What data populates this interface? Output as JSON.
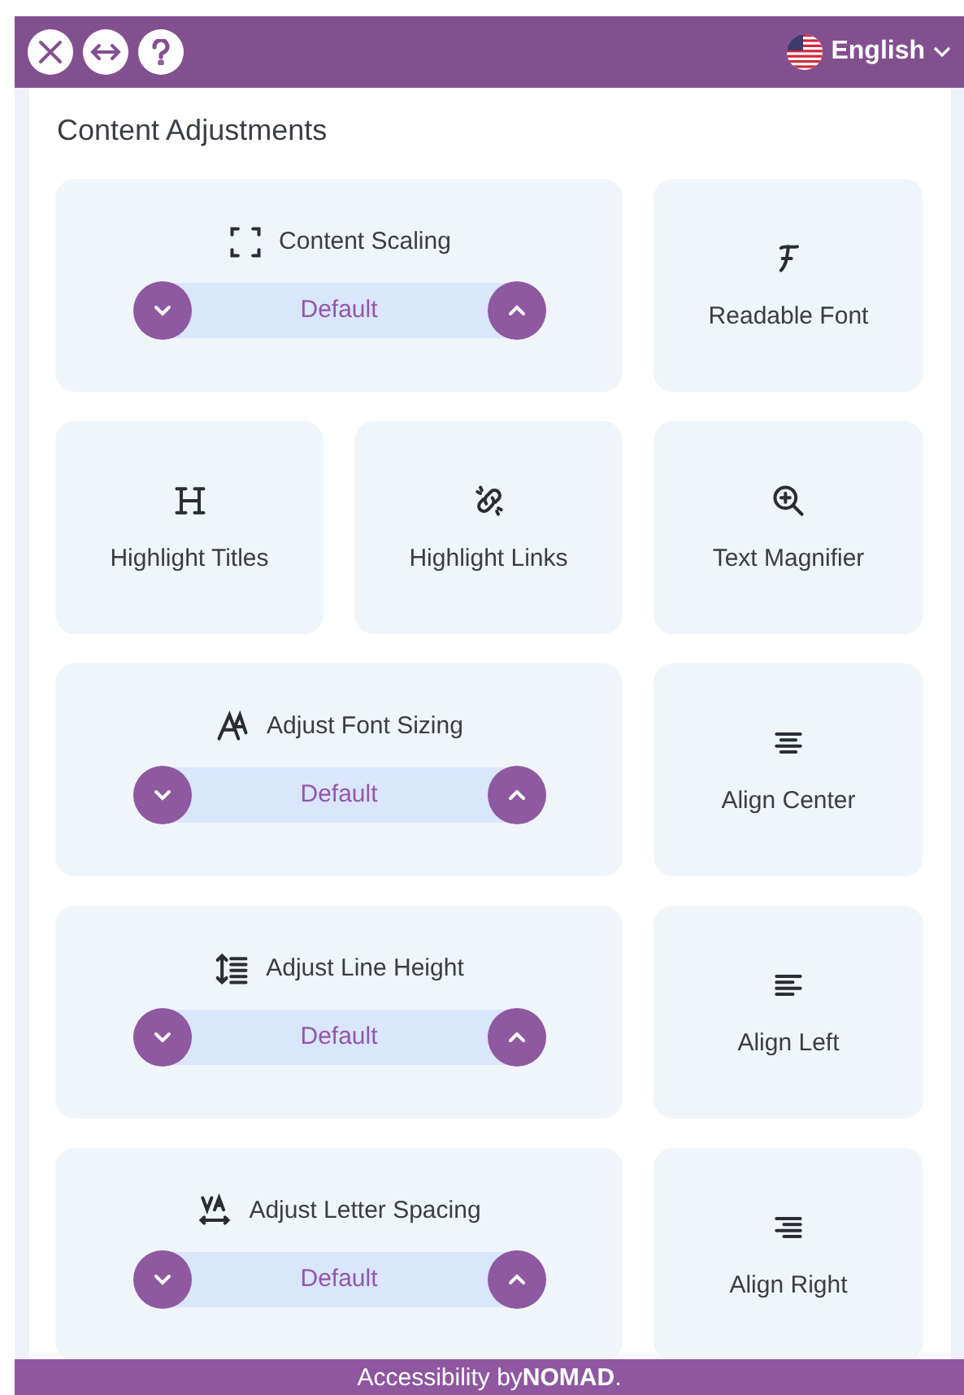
{
  "header": {
    "language": {
      "label": "English"
    }
  },
  "section": {
    "title": "Content Adjustments"
  },
  "cards": [
    {
      "kind": "stepper",
      "label": "Content Scaling",
      "value": "Default"
    },
    {
      "kind": "toggle",
      "label": "Readable Font"
    },
    {
      "kind": "toggle",
      "label": "Highlight Titles"
    },
    {
      "kind": "toggle",
      "label": "Highlight Links"
    },
    {
      "kind": "toggle",
      "label": "Text Magnifier"
    },
    {
      "kind": "stepper",
      "label": "Adjust Font Sizing",
      "value": "Default"
    },
    {
      "kind": "toggle",
      "label": "Align Center"
    },
    {
      "kind": "stepper",
      "label": "Adjust Line Height",
      "value": "Default"
    },
    {
      "kind": "toggle",
      "label": "Align Left"
    },
    {
      "kind": "stepper",
      "label": "Adjust Letter Spacing",
      "value": "Default"
    },
    {
      "kind": "toggle",
      "label": "Align Right"
    }
  ],
  "footer": {
    "text": "Accessibility by**NOMAD**."
  }
}
